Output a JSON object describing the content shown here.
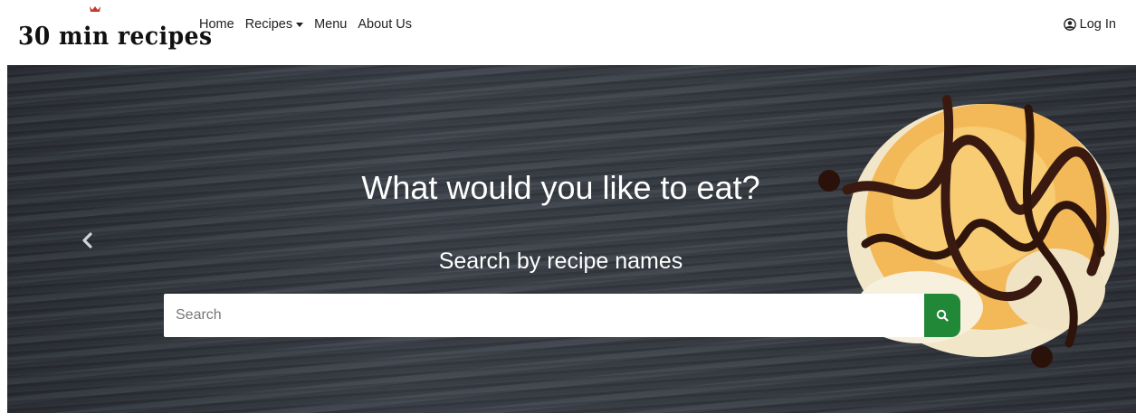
{
  "brand": {
    "name": "30 min recipes"
  },
  "nav": {
    "items": [
      {
        "label": "Home",
        "has_dropdown": false
      },
      {
        "label": "Recipes",
        "has_dropdown": true
      },
      {
        "label": "Menu",
        "has_dropdown": false
      },
      {
        "label": "About Us",
        "has_dropdown": false
      }
    ],
    "login_label": "Log In",
    "login_icon": "user-circle-icon"
  },
  "hero": {
    "title": "What would you like to eat?",
    "subtitle": "Search by recipe names",
    "prev_icon": "chevron-left-icon"
  },
  "search": {
    "placeholder": "Search",
    "value": "",
    "button_icon": "search-icon",
    "button_color": "#218838"
  }
}
